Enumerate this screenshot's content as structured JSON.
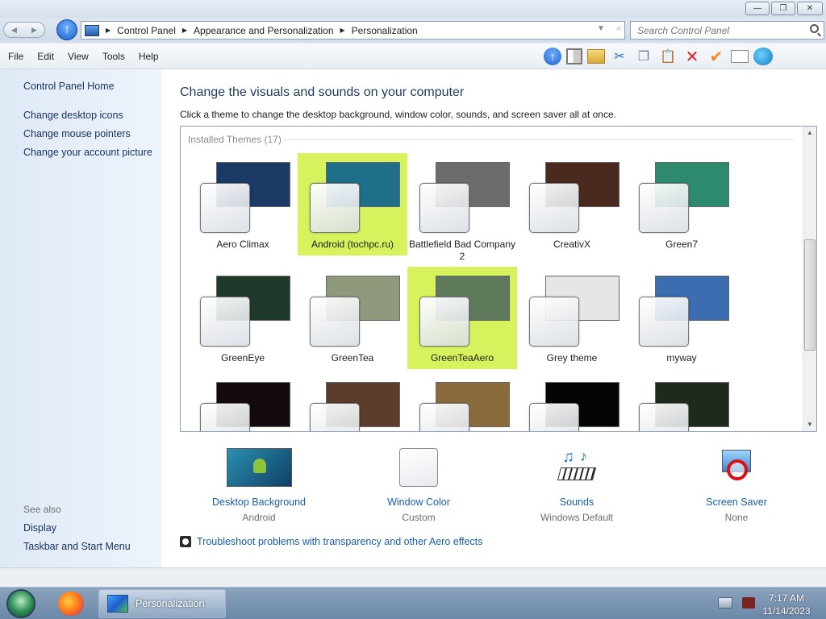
{
  "window": {
    "minimize": "—",
    "restore": "❐",
    "close": "✕"
  },
  "address": {
    "crumbs": [
      "Control Panel",
      "Appearance and Personalization",
      "Personalization"
    ],
    "search_placeholder": "Search Control Panel"
  },
  "menu": [
    "File",
    "Edit",
    "View",
    "Tools",
    "Help"
  ],
  "toolbar_icons": [
    "up-icon",
    "panel-icon",
    "folder-icon",
    "cut-icon",
    "copy-icon",
    "paste-icon",
    "delete-icon",
    "check-icon",
    "properties-icon",
    "globe-icon"
  ],
  "sidebar": {
    "home": "Control Panel Home",
    "links": [
      "Change desktop icons",
      "Change mouse pointers",
      "Change your account picture"
    ],
    "see_also_label": "See also",
    "see_also": [
      "Display",
      "Taskbar and Start Menu"
    ]
  },
  "main": {
    "title": "Change the visuals and sounds on your computer",
    "subtitle": "Click a theme to change the desktop background, window color, sounds, and screen saver all at once.",
    "installed_label": "Installed Themes (17)",
    "themes": [
      {
        "label": "Aero Climax",
        "selected": false,
        "color": "#1b3a66"
      },
      {
        "label": "Android (tochpc.ru)",
        "selected": true,
        "color": "#1f6e8a"
      },
      {
        "label": "Battlefield Bad Company 2",
        "selected": false,
        "color": "#6c6c6c"
      },
      {
        "label": "CreativX",
        "selected": false,
        "color": "#4a2a1e"
      },
      {
        "label": "Green7",
        "selected": false,
        "color": "#2d8a6e"
      },
      {
        "label": "GreenEye",
        "selected": false,
        "color": "#1f3a2a"
      },
      {
        "label": "GreenTea",
        "selected": false,
        "color": "#8f9a7c"
      },
      {
        "label": "GreenTeaAero",
        "selected": true,
        "color": "#5f7a5a"
      },
      {
        "label": "Grey theme",
        "selected": false,
        "color": "#e6e6e6"
      },
      {
        "label": "myway",
        "selected": false,
        "color": "#3b6db0"
      },
      {
        "label": "",
        "selected": false,
        "color": "#140c0c"
      },
      {
        "label": "",
        "selected": false,
        "color": "#5a3d2a"
      },
      {
        "label": "",
        "selected": false,
        "color": "#8a6a3a"
      },
      {
        "label": "",
        "selected": false,
        "color": "#050505"
      },
      {
        "label": "",
        "selected": false,
        "color": "#1f2a1f"
      }
    ],
    "options": [
      {
        "link": "Desktop Background",
        "value": "Android"
      },
      {
        "link": "Window Color",
        "value": "Custom"
      },
      {
        "link": "Sounds",
        "value": "Windows Default"
      },
      {
        "link": "Screen Saver",
        "value": "None"
      }
    ],
    "troubleshoot": "Troubleshoot problems with transparency and other Aero effects"
  },
  "taskbar": {
    "window_label": "Personalization",
    "time": "7:17 AM",
    "date": "11/14/2023"
  }
}
